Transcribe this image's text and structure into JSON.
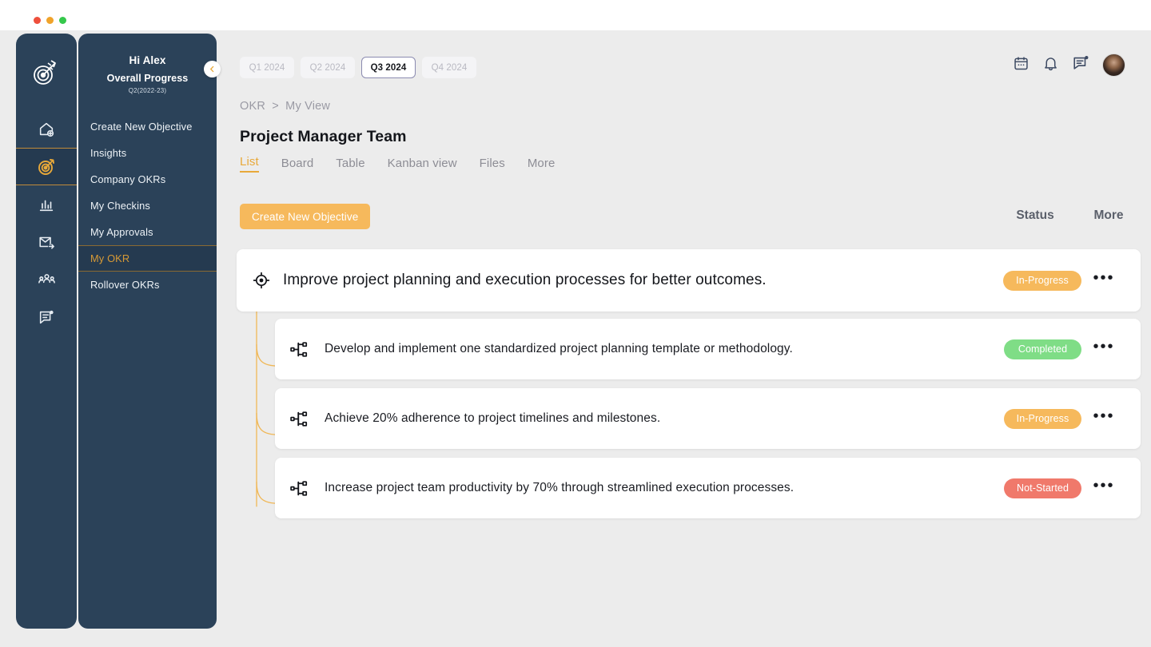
{
  "window": {
    "dots": [
      "close",
      "minimize",
      "maximize"
    ]
  },
  "rail": {
    "logo_icon": "target-arrows-logo",
    "items": [
      {
        "icon": "home-plus-icon",
        "name": "home",
        "active": false
      },
      {
        "icon": "target-icon",
        "name": "okr",
        "active": true
      },
      {
        "icon": "bar-chart-icon",
        "name": "analytics",
        "active": false
      },
      {
        "icon": "mail-send-icon",
        "name": "messages",
        "active": false
      },
      {
        "icon": "people-group-icon",
        "name": "teams",
        "active": false
      },
      {
        "icon": "feedback-note-icon",
        "name": "feedback",
        "active": false
      }
    ]
  },
  "sidebar": {
    "greeting": "Hi Alex",
    "subtitle": "Overall Progress",
    "period": "Q2(2022-23)",
    "collapse_icon": "chevron-left-icon",
    "items": [
      {
        "label": "Create New Objective",
        "active": false
      },
      {
        "label": "Insights",
        "active": false
      },
      {
        "label": "Company OKRs",
        "active": false
      },
      {
        "label": "My  Checkins",
        "active": false
      },
      {
        "label": "My Approvals",
        "active": false
      },
      {
        "label": "My OKR",
        "active": true
      },
      {
        "label": "Rollover OKRs",
        "active": false
      }
    ]
  },
  "header": {
    "quarters": [
      {
        "label": "Q1 2024",
        "active": false
      },
      {
        "label": "Q2 2024",
        "active": false
      },
      {
        "label": "Q3 2024",
        "active": true
      },
      {
        "label": "Q4 2024",
        "active": false
      }
    ],
    "icons": [
      {
        "icon": "calendar-icon",
        "name": "calendar"
      },
      {
        "icon": "bell-icon",
        "name": "notifications"
      },
      {
        "icon": "chat-message-icon",
        "name": "messages",
        "badge": true
      }
    ],
    "avatar": "user-avatar"
  },
  "breadcrumb": {
    "root": "OKR",
    "separator": ">",
    "current": "My View"
  },
  "page": {
    "title": "Project Manager Team",
    "tabs": [
      {
        "label": "List",
        "active": true
      },
      {
        "label": "Board",
        "active": false
      },
      {
        "label": "Table",
        "active": false
      },
      {
        "label": "Kanban view",
        "active": false
      },
      {
        "label": "Files",
        "active": false
      },
      {
        "label": "More",
        "active": false
      }
    ]
  },
  "toolbar": {
    "create_label": "Create New Objective",
    "status_header": "Status",
    "more_header": "More",
    "more_glyph": "•••"
  },
  "statuses": {
    "In-Progress": "#f6b95c",
    "Completed": "#7fdd86",
    "Not-Started": "#f0796b"
  },
  "objective": {
    "icon": "crosshair-target-icon",
    "text": "Improve project planning and execution processes for better outcomes.",
    "status": "In-Progress"
  },
  "key_results": [
    {
      "icon": "hierarchy-node-icon",
      "text": "Develop and implement one standardized project planning template or methodology.",
      "status": "Completed"
    },
    {
      "icon": "hierarchy-node-icon",
      "text": "Achieve 20% adherence to project timelines and milestones.",
      "status": "In-Progress"
    },
    {
      "icon": "hierarchy-node-icon",
      "text": "Increase project team productivity by 70% through streamlined execution processes.",
      "status": "Not-Started"
    }
  ],
  "colors": {
    "sidebar_bg": "#2b4259",
    "accent": "#e8a93a",
    "page_bg": "#ececec",
    "connector": "#f0b755"
  }
}
